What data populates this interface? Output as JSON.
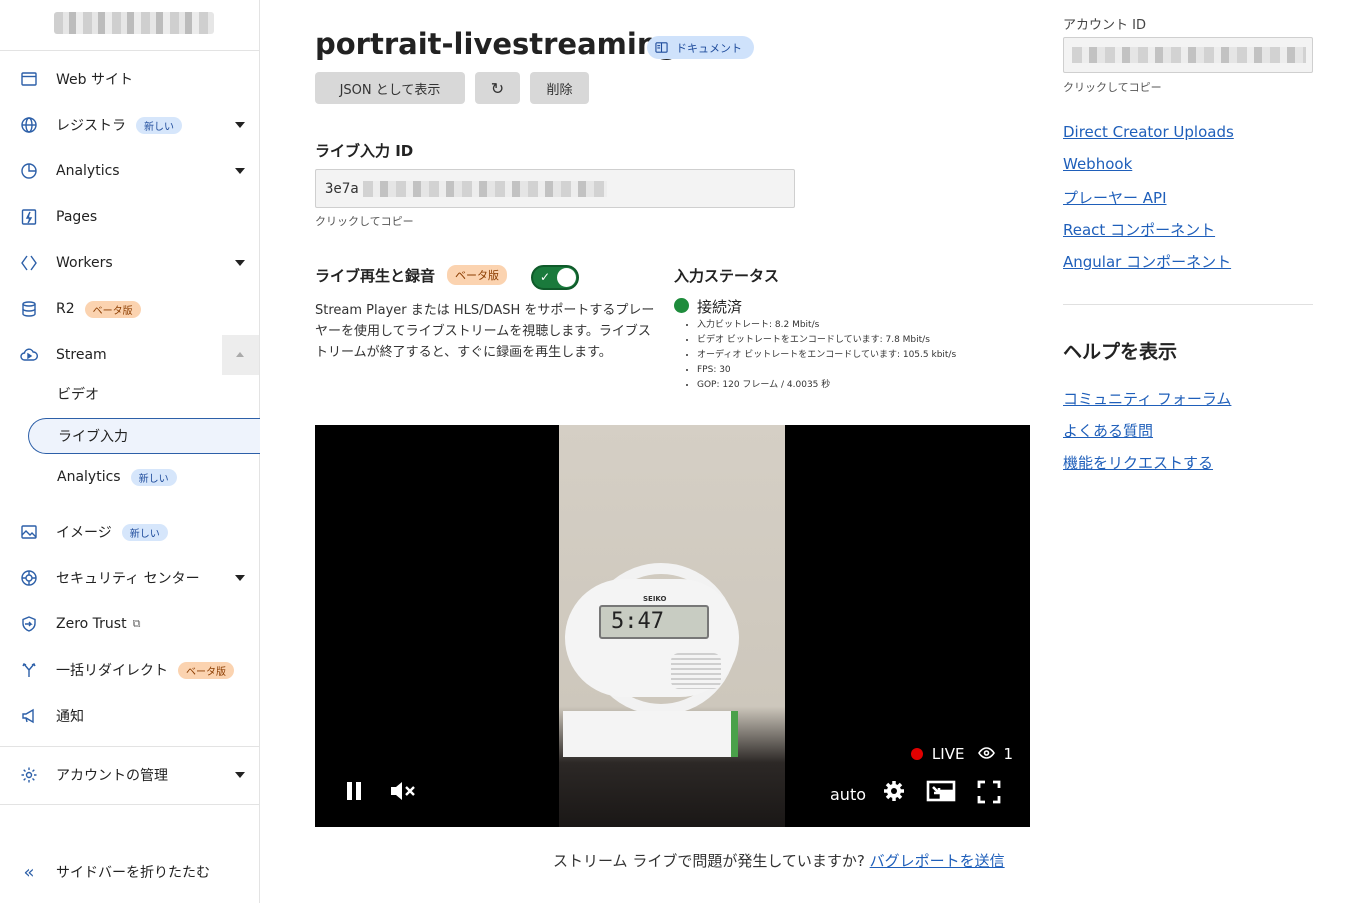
{
  "sidebar": {
    "items": [
      {
        "label": "Web サイト",
        "icon": "browser-window-icon"
      },
      {
        "label": "レジストラ",
        "icon": "globe-icon",
        "badge": "新しい"
      },
      {
        "label": "Analytics",
        "icon": "pie-chart-icon"
      },
      {
        "label": "Pages",
        "icon": "lightning-page-icon"
      },
      {
        "label": "Workers",
        "icon": "diamond-code-icon"
      },
      {
        "label": "R2",
        "icon": "database-icon",
        "badge": "ベータ版"
      },
      {
        "label": "Stream",
        "icon": "cloud-play-icon"
      },
      {
        "label": "イメージ",
        "icon": "image-icon",
        "badge": "新しい"
      },
      {
        "label": "セキュリティ センター",
        "icon": "security-gear-icon"
      },
      {
        "label": "Zero Trust",
        "icon": "zero-trust-shield-icon"
      },
      {
        "label": "一括リダイレクト",
        "icon": "redirect-fork-icon",
        "badge": "ベータ版"
      },
      {
        "label": "通知",
        "icon": "megaphone-icon"
      },
      {
        "label": "アカウントの管理",
        "icon": "gear-icon"
      }
    ],
    "stream_sub": [
      {
        "label": "ビデオ"
      },
      {
        "label": "ライブ入力"
      },
      {
        "label": "Analytics",
        "badge": "新しい"
      }
    ],
    "collapse_label": "サイドバーを折りたたむ"
  },
  "header": {
    "title": "portrait-livestreaming",
    "doc_badge": "ドキュメント",
    "json_button": "JSON として表示",
    "delete_button": "削除"
  },
  "input_id": {
    "label": "ライブ入力 ID",
    "value_prefix": "3e7a",
    "copy_hint": "クリックしてコピー"
  },
  "recording": {
    "label": "ライブ再生と録音",
    "badge": "ベータ版",
    "enabled": true,
    "description": "Stream Player または HLS/DASH をサポートするプレーヤーを使用してライブストリームを視聴します。ライブストリームが終了すると、すぐに録画を再生します。"
  },
  "status": {
    "label": "入力ステータス",
    "state": "接続済",
    "color": "#1e8c3c",
    "stats": [
      "入力ビットレート: 8.2 Mbit/s",
      "ビデオ ビットレートをエンコードしています: 7.8 Mbit/s",
      "オーディオ ビットレートをエンコードしています: 105.5 kbit/s",
      "FPS: 30",
      "GOP: 120 フレーム / 4.0035 秒"
    ]
  },
  "player": {
    "live_label": "LIVE",
    "viewers": "1",
    "quality": "auto",
    "clock_time": "5:47",
    "clock_brand": "SEIKO"
  },
  "footer": {
    "question": "ストリーム ライブで問題が発生していますか?",
    "link": "バグレポートを送信"
  },
  "right": {
    "account_label": "アカウント ID",
    "copy_hint": "クリックしてコピー",
    "links": [
      "Direct Creator Uploads",
      "Webhook",
      "プレーヤー API",
      "React コンポーネント",
      "Angular コンポーネント"
    ],
    "help_title": "ヘルプを表示",
    "help_links": [
      "コミュニティ フォーラム",
      "よくある質問",
      "機能をリクエストする"
    ]
  },
  "colors": {
    "accent": "#1f5fba",
    "toggle_on": "#1a7a3c",
    "live_red": "#e00000"
  }
}
